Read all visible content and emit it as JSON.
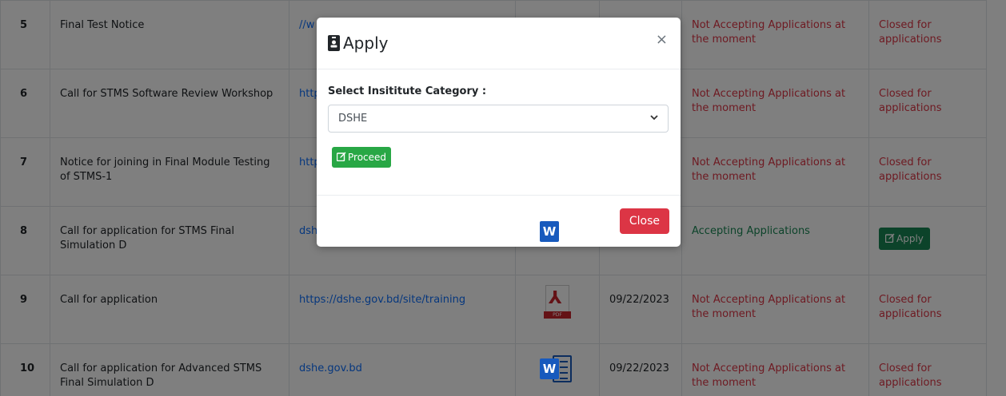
{
  "table": {
    "rows": [
      {
        "num": "5",
        "title": "Final Test Notice",
        "link": "//w",
        "file": "",
        "date": "",
        "status": "Not Accepting Applications at the moment",
        "status_type": "closed",
        "action": "Closed for applications",
        "action_type": "text"
      },
      {
        "num": "6",
        "title": "Call for STMS Software Review Workshop",
        "link": "http",
        "file": "",
        "date": "",
        "status": "Not Accepting Applications at the moment",
        "status_type": "closed",
        "action": "Closed for applications",
        "action_type": "text"
      },
      {
        "num": "7",
        "title": "Notice for joining in Final Module Testing of STMS-1",
        "link": "http",
        "file": "",
        "date": "",
        "status": "Not Accepting Applications at the moment",
        "status_type": "closed",
        "action": "Closed for applications",
        "action_type": "text"
      },
      {
        "num": "8",
        "title": "Call for application for STMS Final Simulation D",
        "link": "dsh",
        "file": "word",
        "date": "",
        "status": "Accepting Applications",
        "status_type": "open",
        "action": "Apply",
        "action_type": "button"
      },
      {
        "num": "9",
        "title": "Call for application",
        "link": "https://dshe.gov.bd/site/training",
        "file": "pdf",
        "date": "09/22/2023",
        "status": "Not Accepting Applications at the moment",
        "status_type": "closed",
        "action": "Closed for applications",
        "action_type": "text"
      },
      {
        "num": "10",
        "title": "Call for application for Advanced STMS Final Simulation D",
        "link": "dshe.gov.bd",
        "file": "word",
        "date": "09/22/2023",
        "status": "Not Accepting Applications at the moment",
        "status_type": "closed",
        "action": "Closed for applications",
        "action_type": "text"
      }
    ]
  },
  "modal": {
    "title": "Apply",
    "field_label": "Select Insititute Category :",
    "select_value": "DSHE",
    "proceed_label": "Proceed",
    "close_label": "Close",
    "close_x": "×"
  },
  "icons": {
    "pdf_band": "PDF",
    "word_letter": "W"
  },
  "colors": {
    "closed_red": "#dc3545",
    "open_green": "#198754",
    "proceed_green": "#28a745",
    "link_blue": "#0d6efd"
  }
}
